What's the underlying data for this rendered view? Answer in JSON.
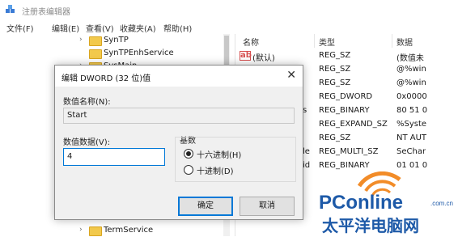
{
  "window": {
    "title": "注册表编辑器"
  },
  "menu": [
    "文件(F)",
    "编辑(E)",
    "查看(V)",
    "收藏夹(A)",
    "帮助(H)"
  ],
  "tree": {
    "items": [
      {
        "label": "SynTP"
      },
      {
        "label": "SynTPEnhService"
      },
      {
        "label": "SysMain"
      },
      {
        "label": "TermService"
      }
    ]
  },
  "list": {
    "headers": {
      "name": "名称",
      "type": "类型",
      "data": "数据"
    },
    "rows": [
      {
        "name": "(默认)",
        "type": "REG_SZ",
        "data": "(数值未"
      },
      {
        "name": "",
        "type": "REG_SZ",
        "data": "@%win"
      },
      {
        "name": "",
        "type": "REG_SZ",
        "data": "@%win"
      },
      {
        "name": "",
        "type": "REG_DWORD",
        "data": "0x0000"
      },
      {
        "name": "s",
        "type": "REG_BINARY",
        "data": "80 51 0"
      },
      {
        "name": "",
        "type": "REG_EXPAND_SZ",
        "data": "%Syste"
      },
      {
        "name": "",
        "type": "REG_SZ",
        "data": "NT AUT"
      },
      {
        "name": "le",
        "type": "REG_MULTI_SZ",
        "data": "SeChar"
      },
      {
        "name": "id",
        "type": "REG_BINARY",
        "data": "01 01 0"
      }
    ]
  },
  "dialog": {
    "title": "编辑 DWORD (32 位)值",
    "close": "✕",
    "value_name_label": "数值名称(N):",
    "value_name": "Start",
    "value_data_label": "数值数据(V):",
    "value_data": "4",
    "base_label": "基数",
    "base_options": [
      {
        "label": "十六进制(H)",
        "checked": true
      },
      {
        "label": "十进制(D)",
        "checked": false
      }
    ],
    "ok": "确定",
    "cancel": "取消"
  },
  "watermark": {
    "brand": "PConline",
    "domain": ".com.cn",
    "cn": "太平洋电脑网"
  },
  "colors": {
    "accent": "#0078d7",
    "watermark_blue": "#1e5aa8",
    "watermark_orange": "#f28c28"
  }
}
